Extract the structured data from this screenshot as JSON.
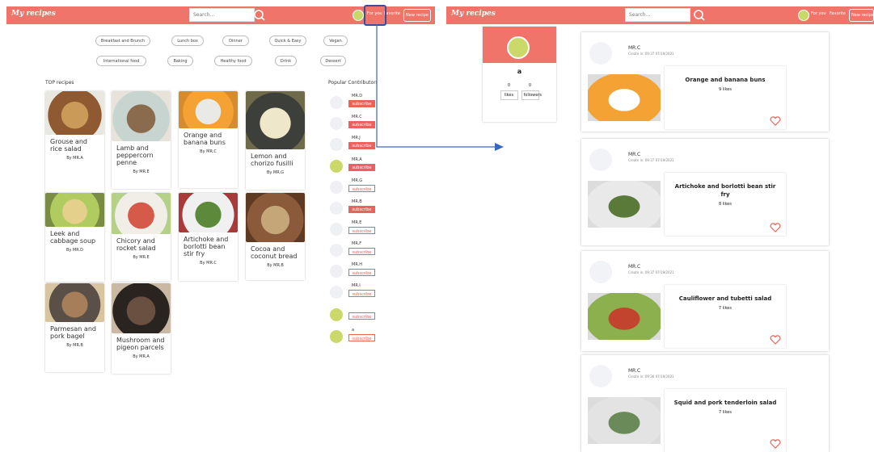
{
  "left": {
    "header": {
      "logo": "My recipes",
      "search_placeholder": "Search...",
      "nav_for_you": "For you",
      "nav_favorite": "Favorite",
      "new_recipe": "New recipe"
    },
    "categories": [
      "Breakfast and Brunch",
      "Lunch box",
      "Dinner",
      "Quick & Easy",
      "Vegan",
      "International food",
      "Baking",
      "Healthy food",
      "Drink",
      "Dessert"
    ],
    "top_recipes_title": "TOP recipes",
    "recipes": [
      {
        "title": "Grouse and rice salad",
        "by": "By MR.A"
      },
      {
        "title": "Lamb and peppercorn penne",
        "by": "By MR.E"
      },
      {
        "title": "Orange and banana buns",
        "by": "By MR.C"
      },
      {
        "title": "Lemon and chorizo fusilli",
        "by": "By MR.G"
      },
      {
        "title": "Leek and cabbage soup",
        "by": "By MR.D"
      },
      {
        "title": "Chicory and rocket salad",
        "by": "By MR.E"
      },
      {
        "title": "Artichoke and borlotti bean stir fry",
        "by": "By MR.C"
      },
      {
        "title": "Cocoa and coconut bread",
        "by": "By MR.B"
      },
      {
        "title": "Parmesan and pork bagel",
        "by": "By MR.B"
      },
      {
        "title": "Mushroom and pigeon parcels",
        "by": "By MR.A"
      }
    ],
    "contributors_title": "Popular Contributors",
    "contributors": [
      {
        "name": "MR.D",
        "sub": "subscribe",
        "subscribed": true
      },
      {
        "name": "MR.C",
        "sub": "subscribe",
        "subscribed": true
      },
      {
        "name": "MR.J",
        "sub": "subscribe",
        "subscribed": true
      },
      {
        "name": "MR.A",
        "sub": "subscribe",
        "subscribed": true
      },
      {
        "name": "MR.G",
        "sub": "subscribe",
        "subscribed": false
      },
      {
        "name": "MR.B",
        "sub": "subscribe",
        "subscribed": true
      },
      {
        "name": "MR.E",
        "sub": "subscribe",
        "subscribed": false
      },
      {
        "name": "MR.F",
        "sub": "subscribe",
        "subscribed": false
      },
      {
        "name": "MR.H",
        "sub": "subscribe",
        "subscribed": false
      },
      {
        "name": "MR.I",
        "sub": "subscribe",
        "subscribed": false
      },
      {
        "name": "",
        "sub": "subscribe",
        "subscribed": false
      },
      {
        "name": "a",
        "sub": "subscribe",
        "subscribed": false
      }
    ]
  },
  "right": {
    "header": {
      "logo": "My recipes",
      "search_placeholder": "Search...",
      "nav_for_you": "For you",
      "nav_favorite": "Favorite",
      "new_recipe": "New recipe"
    },
    "profile": {
      "name": "a",
      "likes_count": "0",
      "followers_count": "0",
      "likes_label": "likes",
      "followers_label": "followers"
    },
    "posts": [
      {
        "author": "MR.C",
        "date": "Create in: 09:37 07/19/2021",
        "title": "Orange and banana buns",
        "likes": "9 likes"
      },
      {
        "author": "MR.C",
        "date": "Create in: 09:37 07/19/2021",
        "title": "Artichoke and borlotti bean stir fry",
        "likes": "8 likes"
      },
      {
        "author": "MR.C",
        "date": "Create in: 09:37 07/19/2021",
        "title": "Cauliflower and tubetti salad",
        "likes": "7 likes"
      },
      {
        "author": "MR.C",
        "date": "Create in: 09:36 07/19/2021",
        "title": "Squid and pork tenderloin salad",
        "likes": "7 likes"
      }
    ]
  },
  "colors": {
    "accent": "#f0746a",
    "subscribe": "#e9635c",
    "arrow": "#3a66c4"
  }
}
